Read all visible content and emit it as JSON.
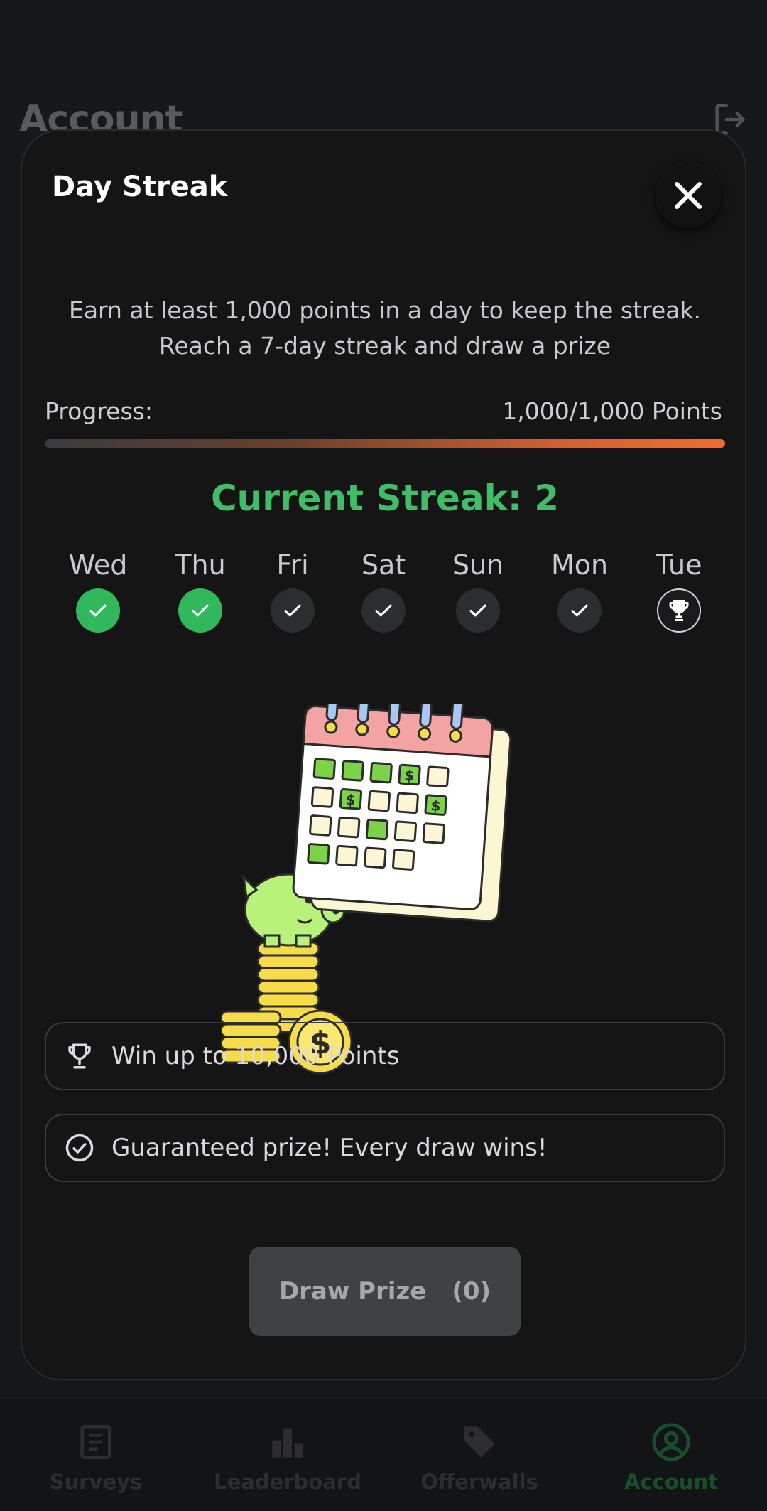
{
  "app": {
    "title": "Account",
    "nav": [
      {
        "label": "Surveys",
        "icon": "document-icon"
      },
      {
        "label": "Leaderboard",
        "icon": "bar-chart-icon"
      },
      {
        "label": "Offerwalls",
        "icon": "tag-icon"
      },
      {
        "label": "Account",
        "icon": "user-circle-icon",
        "active": true
      }
    ]
  },
  "modal": {
    "title": "Day Streak",
    "description_line1": "Earn at least 1,000 points in a day to keep the streak.",
    "description_line2": "Reach a 7-day streak and draw a prize",
    "progress_label": "Progress:",
    "progress_value": "1,000/1,000 Points",
    "progress_fraction": 1.0,
    "streak_title": "Current Streak: 2",
    "days": [
      {
        "label": "Wed",
        "state": "done"
      },
      {
        "label": "Thu",
        "state": "done"
      },
      {
        "label": "Fri",
        "state": "pending"
      },
      {
        "label": "Sat",
        "state": "pending"
      },
      {
        "label": "Sun",
        "state": "pending"
      },
      {
        "label": "Mon",
        "state": "pending"
      },
      {
        "label": "Tue",
        "state": "prize"
      }
    ],
    "info": [
      {
        "icon": "trophy-icon",
        "text": "Win up to 10,000 Points"
      },
      {
        "icon": "check-circle-icon",
        "text": "Guaranteed prize! Every draw wins!"
      }
    ],
    "draw_label": "Draw Prize",
    "draw_count": "(0)"
  },
  "colors": {
    "accent_green": "#3fbe67",
    "progress_orange": "#f26b30",
    "modal_bg": "#151515"
  }
}
